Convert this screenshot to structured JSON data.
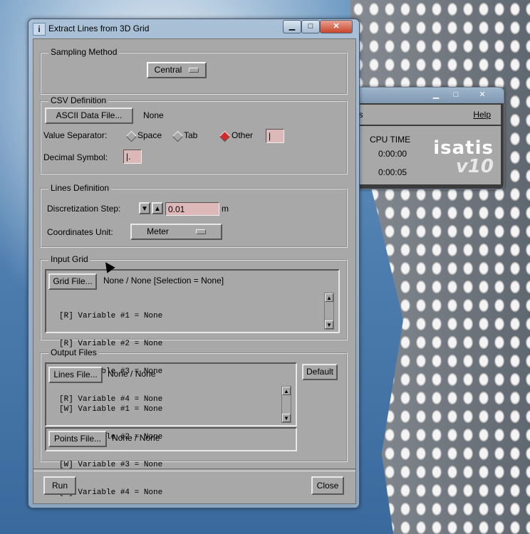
{
  "background_window": {
    "menu_left": "es",
    "menu_help": "Help",
    "cpu_label": "CPU TIME",
    "cpu_value1": "0:00:00",
    "cpu_value2": "0:00:05",
    "logo_line1": "isatis",
    "logo_line2": "v10"
  },
  "window": {
    "title": "Extract Lines from 3D Grid",
    "icon_glyph": "i",
    "minimize": "▁",
    "maximize": "□",
    "close": "✕"
  },
  "sampling": {
    "label": "Sampling Method",
    "value": "Central"
  },
  "csv": {
    "label": "CSV Definition",
    "ascii_button": "ASCII Data File...",
    "ascii_value": "None",
    "separator_label": "Value Separator:",
    "options": [
      "Space",
      "Tab",
      "Other"
    ],
    "selected": "Other",
    "other_value": "|",
    "decimal_label": "Decimal Symbol:",
    "decimal_value": "|."
  },
  "lines": {
    "label": "Lines Definition",
    "step_label": "Discretization Step:",
    "step_value": "0.01",
    "step_unit": "m",
    "coord_label": "Coordinates Unit:",
    "coord_value": "Meter"
  },
  "input_grid": {
    "label": "Input Grid",
    "button": "Grid File...",
    "value": "None / None [Selection = None]",
    "variables": [
      "[R] Variable #1 = None",
      "[R] Variable #2 = None",
      "[R] Variable #3 = None",
      "[R] Variable #4 = None"
    ]
  },
  "output": {
    "label": "Output Files",
    "lines_button": "Lines File...",
    "lines_value": "None / None",
    "default_button": "Default",
    "variables": [
      "[W] Variable #1 = None",
      "[W] Variable #2 = None",
      "[W] Variable #3 = None",
      "[W] Variable #4 = None"
    ],
    "points_button": "Points File...",
    "points_value": "None / None"
  },
  "footer": {
    "run": "Run",
    "close": "Close"
  }
}
